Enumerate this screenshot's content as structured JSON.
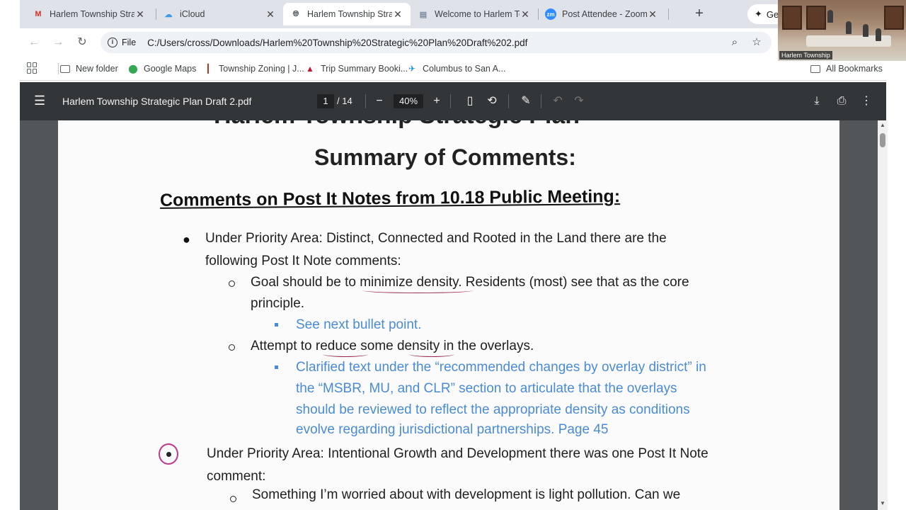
{
  "tabs": [
    {
      "title": "Harlem Township Stra",
      "favicon": "gmail-icon"
    },
    {
      "title": "iCloud",
      "favicon": "icloud-icon"
    },
    {
      "title": "Harlem Township Strat",
      "favicon": "globe-icon"
    },
    {
      "title": "Welcome to Harlem Tc",
      "favicon": "site-icon"
    },
    {
      "title": "Post Attendee - Zoom",
      "favicon": "zoom-icon"
    }
  ],
  "gemini_label": "Gemini",
  "address": {
    "scheme_label": "File",
    "url": "C:/Users/cross/Downloads/Harlem%20Township%20Strategic%20Plan%20Draft%202.pdf"
  },
  "bookmarks": [
    "New folder",
    "Google Maps",
    "Township Zoning | J...",
    "Trip Summary Booki...",
    "Columbus to San A..."
  ],
  "all_bookmarks_label": "All Bookmarks",
  "pdf": {
    "title": "Harlem Township Strategic Plan Draft 2.pdf",
    "page_current": "1",
    "page_total": "/ 14",
    "zoom": "40%"
  },
  "document": {
    "cut_heading": "Harlem Township Strategic Plan",
    "summary_heading": "Summary of Comments:",
    "section_heading": "Comments on Post It Notes from 10.18 Public Meeting:",
    "item1_line1": "Under Priority Area: Distinct, Connected and Rooted in the Land there are the",
    "item1_line2": "following Post It Note comments:",
    "sub1_line1": "Goal should be to minimize density.  Residents (most) see that as the core",
    "sub1_line2": "principle.",
    "sub1_response": "See next bullet point.",
    "sub2_line1": "Attempt to reduce some density in the overlays.",
    "sub2_response_line1": "Clarified text under the “recommended changes by overlay district” in",
    "sub2_response_line2": "the “MSBR, MU, and CLR” section to articulate that the overlays",
    "sub2_response_line3": "should be reviewed to reflect the appropriate density as conditions",
    "sub2_response_line4": "evolve regarding jurisdictional partnerships. Page 45",
    "item2_line1": "Under Priority Area: Intentional Growth and Development there was one Post It Note",
    "item2_line2": "comment:",
    "sub3_line1": "Something I’m worried about with development is light pollution.  Can we"
  },
  "video_caption": "Harlem Township",
  "colors": {
    "pdf_toolbar": "#323639",
    "viewer_bg": "#525659",
    "link_blue": "#4a8bd6",
    "annotation_pink": "#c2368a",
    "tabstrip": "#dfe3e9"
  }
}
